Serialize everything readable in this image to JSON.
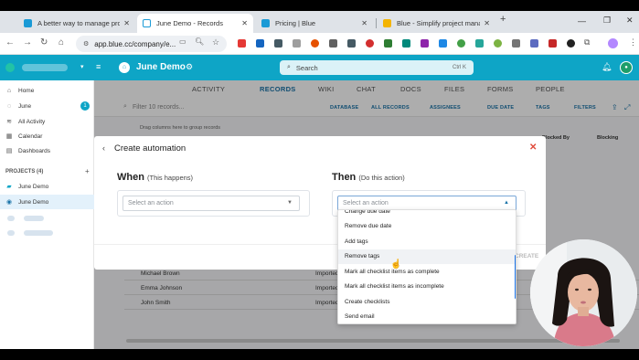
{
  "browser": {
    "tabs": [
      {
        "title": "A better way to manage proje",
        "active": false,
        "favicon_color": "#1a9ad6"
      },
      {
        "title": "June Demo - Records",
        "active": true,
        "favicon_color": "#ffffff"
      },
      {
        "title": "Pricing | Blue",
        "active": false,
        "favicon_color": "#1a9ad6"
      },
      {
        "title": "Blue - Simplify project manage",
        "active": false,
        "favicon_color": "#f4b400"
      }
    ],
    "url": "app.blue.cc/company/e...",
    "new_tab": "+"
  },
  "app": {
    "project_title": "June Demo",
    "search_placeholder": "Search",
    "search_shortcut": "Ctrl K"
  },
  "sidebar": {
    "items": [
      {
        "label": "Home",
        "icon": "home-icon"
      },
      {
        "label": "June",
        "icon": "check-circle-icon",
        "badge": "1"
      },
      {
        "label": "All Activity",
        "icon": "activity-icon"
      },
      {
        "label": "Calendar",
        "icon": "calendar-icon"
      },
      {
        "label": "Dashboards",
        "icon": "dashboard-icon"
      }
    ],
    "projects_header": "PROJECTS (4)",
    "projects": [
      {
        "label": "June Demo",
        "icon": "folder-icon"
      },
      {
        "label": "June Demo",
        "icon": "project-dot-icon",
        "active": true
      }
    ]
  },
  "main": {
    "nav_tabs": [
      "ACTIVITY",
      "RECORDS",
      "WIKI",
      "CHAT",
      "DOCS",
      "FILES",
      "FORMS",
      "PEOPLE"
    ],
    "active_tab": "RECORDS",
    "filter_placeholder": "Filter 10 records...",
    "toolbar": [
      "DATABASE",
      "ALL RECORDS",
      "ASSIGNEES",
      "DUE DATE",
      "TAGS",
      "FILTERS"
    ],
    "drag_hint": "Drag columns here to group records",
    "columns": [
      "Blocked By",
      "Blocking"
    ],
    "rows": [
      {
        "name": "Michael Brown",
        "imported": "Imported"
      },
      {
        "name": "Emma Johnson",
        "imported": "Imported"
      },
      {
        "name": "John Smith",
        "imported": "Imported"
      }
    ]
  },
  "modal": {
    "title": "Create automation",
    "when_label": "When",
    "when_sub": "(This happens)",
    "then_label": "Then",
    "then_sub": "(Do this action)",
    "when_placeholder": "Select an action",
    "then_placeholder": "Select an action",
    "create_label": "CREATE",
    "dropdown_options": [
      "Change due date",
      "Remove due date",
      "Add tags",
      "Remove tags",
      "Mark all checklist items as complete",
      "Mark all checklist items as incomplete",
      "Create checklists",
      "Send email"
    ],
    "hovered_option": "Remove tags"
  },
  "colors": {
    "header": "#0ea5c6",
    "accent": "#1a73a8",
    "close": "#e04a3a"
  }
}
